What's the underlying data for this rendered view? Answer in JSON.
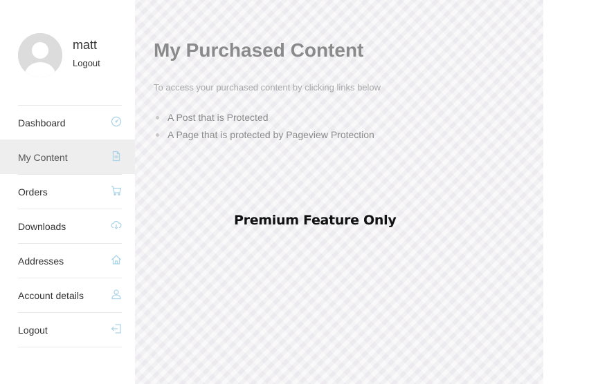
{
  "user": {
    "name": "matt",
    "logout_label": "Logout"
  },
  "nav": {
    "items": [
      {
        "label": "Dashboard",
        "icon": "dashboard-icon"
      },
      {
        "label": "My Content",
        "icon": "file-icon",
        "active": true
      },
      {
        "label": "Orders",
        "icon": "cart-icon"
      },
      {
        "label": "Downloads",
        "icon": "cloud-download-icon"
      },
      {
        "label": "Addresses",
        "icon": "home-icon"
      },
      {
        "label": "Account details",
        "icon": "user-icon"
      },
      {
        "label": "Logout",
        "icon": "logout-icon"
      }
    ]
  },
  "main": {
    "title": "My Purchased Content",
    "intro": "To access your purchased content by clicking links below",
    "links": [
      "A Post that is Protected",
      "A Page that is protected by Pageview Protection"
    ],
    "overlay_text": "Premium Feature Only"
  },
  "colors": {
    "icon": "#a9d3e8",
    "active_bg": "#eeeeee",
    "main_bg": "#f4f3f5"
  }
}
